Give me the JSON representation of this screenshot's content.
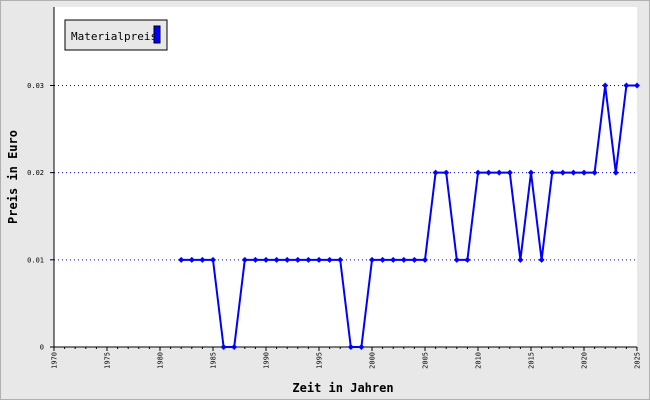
{
  "chart_data": {
    "type": "line",
    "title": "",
    "xlabel": "Zeit in Jahren",
    "ylabel": "Preis in Euro",
    "xlim": [
      1970,
      2025
    ],
    "ylim": [
      0,
      0.039
    ],
    "x_ticks": [
      1970,
      1975,
      1980,
      1985,
      1990,
      1995,
      2000,
      2005,
      2010,
      2015,
      2020,
      2025
    ],
    "x_tick_labels": [
      "1970",
      "1975",
      "1980",
      "1985",
      "1990",
      "1995",
      "2000",
      "2005",
      "2010",
      "2015",
      "2020",
      "2025"
    ],
    "y_ticks": [
      0,
      0.01,
      0.02,
      0.03
    ],
    "y_tick_labels": [
      "0",
      "0.01",
      "0.02",
      "0.03"
    ],
    "grid": "horizontal dotted",
    "legend": {
      "position": "top-left",
      "entries": [
        "Materialpreis"
      ]
    },
    "colors": {
      "series": "#0000ff",
      "grid": "#0000cc",
      "background": "#ffffff",
      "frame": "#e8e8e8"
    },
    "series": [
      {
        "name": "Materialpreis",
        "x": [
          1982,
          1983,
          1984,
          1985,
          1986,
          1987,
          1988,
          1989,
          1990,
          1991,
          1992,
          1993,
          1994,
          1995,
          1996,
          1997,
          1998,
          1999,
          2000,
          2001,
          2002,
          2003,
          2004,
          2005,
          2006,
          2007,
          2008,
          2009,
          2010,
          2011,
          2012,
          2013,
          2014,
          2015,
          2016,
          2017,
          2018,
          2019,
          2020,
          2021,
          2022,
          2023,
          2024,
          2025
        ],
        "values": [
          0.01,
          0.01,
          0.01,
          0.01,
          0,
          0,
          0.01,
          0.01,
          0.01,
          0.01,
          0.01,
          0.01,
          0.01,
          0.01,
          0.01,
          0.01,
          0,
          0,
          0.01,
          0.01,
          0.01,
          0.01,
          0.01,
          0.01,
          0.02,
          0.02,
          0.01,
          0.01,
          0.02,
          0.02,
          0.02,
          0.02,
          0.01,
          0.02,
          0.01,
          0.02,
          0.02,
          0.02,
          0.02,
          0.02,
          0.03,
          0.02,
          0.03,
          0.03
        ]
      }
    ]
  }
}
